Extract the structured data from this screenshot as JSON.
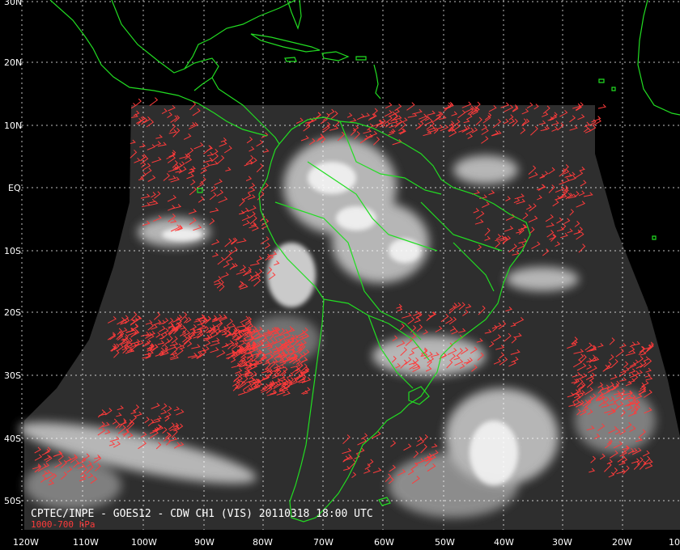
{
  "title": "CPTEC/INPE - GOES12 - CDW CH1 (VIS) 20110318 18:00 UTC",
  "subtitle": "1000-700 hPa",
  "lat_labels": [
    "30N",
    "20N",
    "10N",
    "EQ",
    "10S",
    "20S",
    "30S",
    "40S",
    "50S"
  ],
  "lon_labels": [
    "120W",
    "110W",
    "100W",
    "90W",
    "80W",
    "70W",
    "60W",
    "50W",
    "40W",
    "30W",
    "20W",
    "10"
  ],
  "colors": {
    "coastline": "#22dd22",
    "wind_vectors": "#ff3b3b",
    "grid": "#ffffff",
    "space": "#000000",
    "imagery_gray": "#3a3a3a",
    "cloud": "#e8e8e8"
  }
}
